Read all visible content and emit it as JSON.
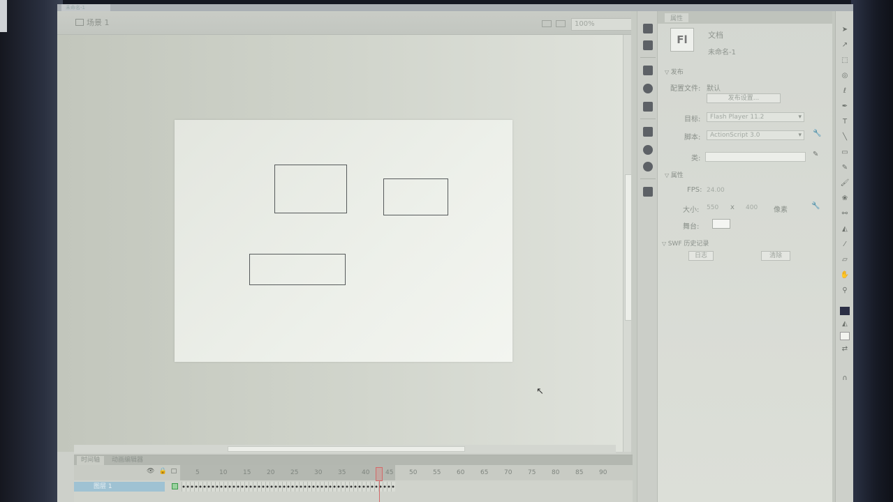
{
  "window": {
    "tab_title": "未命名-1"
  },
  "docbar": {
    "scene_label": "场景 1",
    "zoom": "100%"
  },
  "properties": {
    "tab_label": "属性",
    "badge": "Fl",
    "doc_type": "文档",
    "doc_name": "未命名-1",
    "publish_section": "发布",
    "profile_label": "配置文件:",
    "profile_value": "默认",
    "publish_settings_button": "发布设置...",
    "target_label": "目标:",
    "target_value": "Flash Player 11.2",
    "script_label": "脚本:",
    "script_value": "ActionScript 3.0",
    "class_label": "类:",
    "class_value": "",
    "props_section": "属性",
    "fps_label": "FPS:",
    "fps_value": "24.00",
    "size_label": "大小:",
    "width": "550",
    "times": "x",
    "height": "400",
    "unit": "像素",
    "stage_label": "舞台:",
    "stage_color": "#f4f5f2",
    "swf_history_section": "SWF 历史记录",
    "log_button": "日志",
    "clear_button": "清除"
  },
  "timeline": {
    "tabs": [
      "时间轴",
      "动画编辑器"
    ],
    "layer_name": "图层 1",
    "frame_numbers": [
      "5",
      "10",
      "15",
      "20",
      "25",
      "30",
      "35",
      "40",
      "45",
      "50",
      "55",
      "60",
      "65",
      "70",
      "75",
      "80",
      "85",
      "90"
    ]
  },
  "icons": {
    "strip": [
      "library-icon",
      "swatches-icon",
      "align-icon",
      "info-icon",
      "transform-icon",
      "components-icon",
      "motion-presets-icon",
      "color-icon",
      "code-snippets-icon"
    ],
    "tools": [
      "selection-tool-icon",
      "subselection-tool-icon",
      "free-transform-tool-icon",
      "3d-rotation-tool-icon",
      "lasso-tool-icon",
      "pen-tool-icon",
      "text-tool-icon",
      "line-tool-icon",
      "rectangle-tool-icon",
      "pencil-tool-icon",
      "brush-tool-icon",
      "deco-tool-icon",
      "bone-tool-icon",
      "paint-bucket-tool-icon",
      "eyedropper-tool-icon",
      "eraser-tool-icon",
      "hand-tool-icon",
      "zoom-tool-icon"
    ]
  },
  "colors": {
    "stroke": "#2c2f45",
    "fill": "#f2f3ef",
    "layer_highlight": "#9fc2d3"
  }
}
